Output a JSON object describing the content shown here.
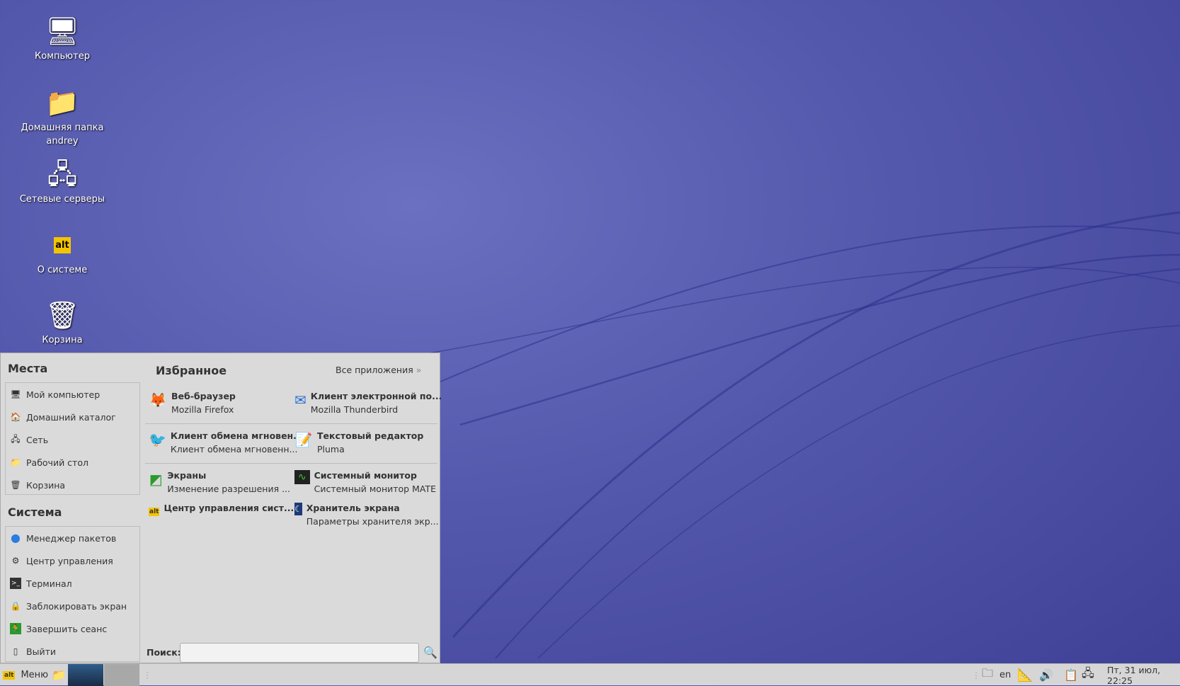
{
  "desktop": {
    "icons": [
      {
        "label": "Компьютер",
        "icon": "computer-icon"
      },
      {
        "label": "Домашняя папка andrey",
        "icon": "home-folder-icon"
      },
      {
        "label": "Сетевые серверы",
        "icon": "network-servers-icon"
      },
      {
        "label": "О системе",
        "icon": "basealt-logo-icon"
      },
      {
        "label": "Корзина",
        "icon": "trash-icon"
      }
    ]
  },
  "menu": {
    "places_title": "Места",
    "places": [
      {
        "label": "Мой компьютер"
      },
      {
        "label": "Домашний каталог"
      },
      {
        "label": "Сеть"
      },
      {
        "label": "Рабочий стол"
      },
      {
        "label": "Корзина"
      }
    ],
    "system_title": "Система",
    "system": [
      {
        "label": "Менеджер пакетов"
      },
      {
        "label": "Центр управления"
      },
      {
        "label": "Терминал"
      },
      {
        "label": "Заблокировать экран"
      },
      {
        "label": "Завершить сеанс"
      },
      {
        "label": "Выйти"
      }
    ],
    "favorites_title": "Избранное",
    "all_apps": "Все приложения",
    "favorites": [
      {
        "name": "Веб-браузер",
        "desc": "Mozilla Firefox"
      },
      {
        "name": "Клиент электронной по...",
        "desc": "Mozilla Thunderbird"
      },
      {
        "name": "Клиент обмена мгновен...",
        "desc": "Клиент обмена мгновенн..."
      },
      {
        "name": "Текстовый редактор",
        "desc": "Pluma"
      },
      {
        "name": "Экраны",
        "desc": "Изменение разрешения ..."
      },
      {
        "name": "Системный монитор",
        "desc": "Системный монитор MATE"
      },
      {
        "name": "Центр управления сист...",
        "desc": ""
      },
      {
        "name": "Хранитель экрана",
        "desc": "Параметры хранителя экр..."
      }
    ],
    "search_label": "Поиск:",
    "search_value": ""
  },
  "taskbar": {
    "menu_label": "Меню",
    "keyboard_layout": "en",
    "clock": "Пт, 31 июл, 22:25"
  }
}
